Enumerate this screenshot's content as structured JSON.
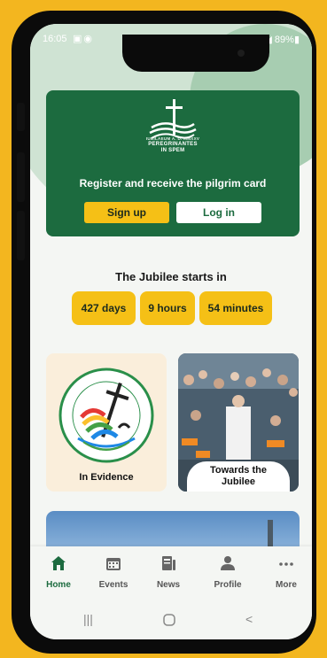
{
  "status_bar": {
    "time": "16:05",
    "battery": "89%"
  },
  "register": {
    "brand_line1": "IUBILAEUM A. D. MMXXV",
    "brand_line2": "PEREGRINANTES",
    "brand_line3": "IN SPEM",
    "text": "Register and receive the pilgrim card",
    "signup_label": "Sign up",
    "login_label": "Log in"
  },
  "countdown": {
    "title": "The Jubilee starts in",
    "days": "427 days",
    "hours": "9 hours",
    "minutes": "54 minutes"
  },
  "tiles": [
    {
      "label": "In Evidence"
    },
    {
      "label_line1": "Towards the",
      "label_line2": "Jubilee"
    }
  ],
  "nav": {
    "items": [
      {
        "label": "Home",
        "icon": "home-icon"
      },
      {
        "label": "Events",
        "icon": "calendar-icon"
      },
      {
        "label": "News",
        "icon": "news-icon"
      },
      {
        "label": "Profile",
        "icon": "person-icon"
      },
      {
        "label": "More",
        "icon": "more-icon"
      }
    ]
  },
  "colors": {
    "brand_green": "#1c6b3f",
    "accent_yellow": "#f5c016",
    "frame_background": "#f3b61f"
  }
}
